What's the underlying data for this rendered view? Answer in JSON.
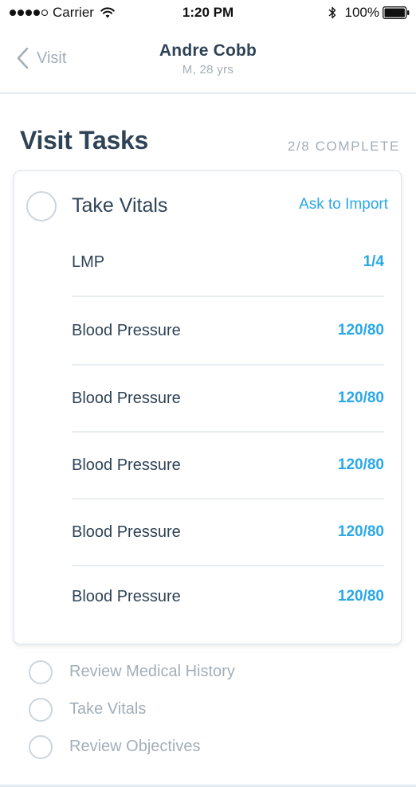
{
  "status_bar": {
    "carrier": "Carrier",
    "time": "1:20 PM",
    "battery": "100%",
    "signal_icon": "signal-dots-icon",
    "wifi_icon": "wifi-icon",
    "bluetooth_icon": "bluetooth-icon",
    "battery_icon": "battery-icon"
  },
  "nav": {
    "back_label": "Visit",
    "back_icon": "chevron-left-icon",
    "title": "Andre Cobb",
    "subtitle": "M, 28 yrs"
  },
  "section": {
    "title": "Visit Tasks",
    "progress": "2/8 COMPLETE"
  },
  "task_card": {
    "title": "Take Vitals",
    "action": "Ask to Import",
    "vitals": [
      {
        "label": "LMP",
        "value": "1/4"
      },
      {
        "label": "Blood Pressure",
        "value": "120/80"
      },
      {
        "label": "Blood Pressure",
        "value": "120/80"
      },
      {
        "label": "Blood Pressure",
        "value": "120/80"
      },
      {
        "label": "Blood Pressure",
        "value": "120/80"
      },
      {
        "label": "Blood Pressure",
        "value": "120/80"
      }
    ]
  },
  "other_tasks": [
    {
      "label": "Review Medical History"
    },
    {
      "label": "Take Vitals"
    },
    {
      "label": "Review Objectives"
    }
  ],
  "colors": {
    "accent": "#2aa8e8",
    "text_dark": "#2f4356",
    "text_muted": "#a3aeb8",
    "divider": "#e7edf2"
  }
}
